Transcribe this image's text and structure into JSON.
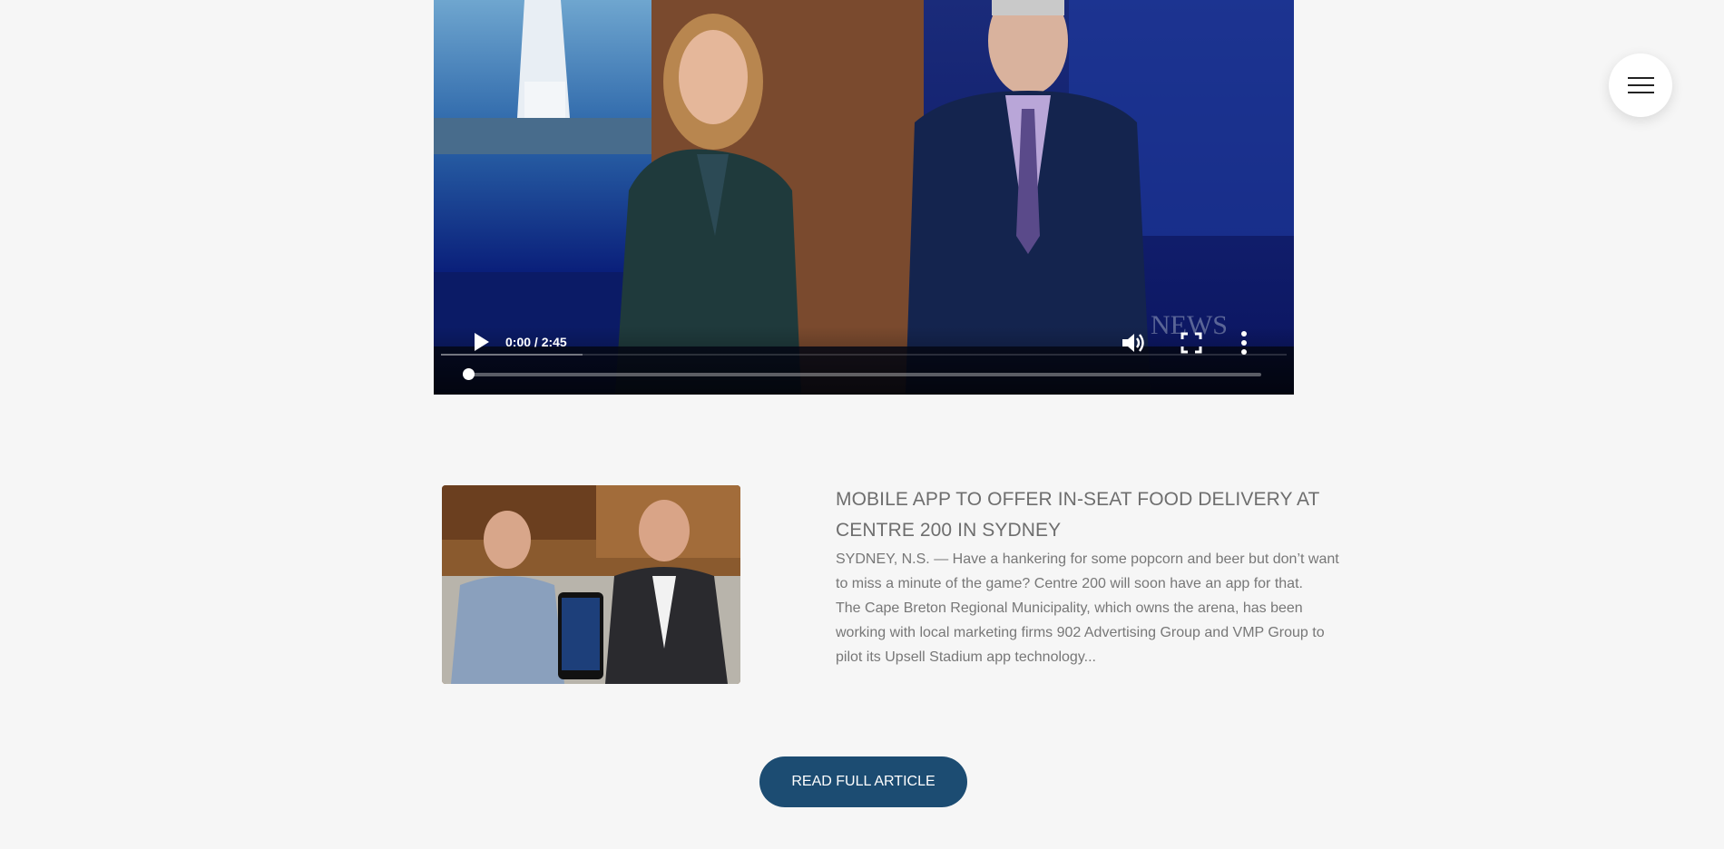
{
  "video": {
    "time": "0:00 / 2:45",
    "progress": 0,
    "watermark_logo": "CTV News Atlantic",
    "icons": {
      "play": "play-icon",
      "volume": "volume-icon",
      "fullscreen": "fullscreen-icon",
      "more": "more-vertical-icon"
    }
  },
  "menu": {
    "icon": "hamburger-menu-icon"
  },
  "article": {
    "headline": "MOBILE APP TO OFFER IN-SEAT FOOD DELIVERY AT CENTRE 200 IN SYDNEY",
    "paragraph_1": "SYDNEY, N.S. — Have a hankering for some popcorn and beer but don’t want to miss a minute of the game? Centre 200 will soon have an app for that.",
    "paragraph_2": "The Cape Breton Regional Municipality, which owns the arena, has been working with local marketing firms 902 Advertising Group and VMP Group to pilot its Upsell Stadium app technology...",
    "read_more_label": "READ FULL ARTICLE"
  }
}
